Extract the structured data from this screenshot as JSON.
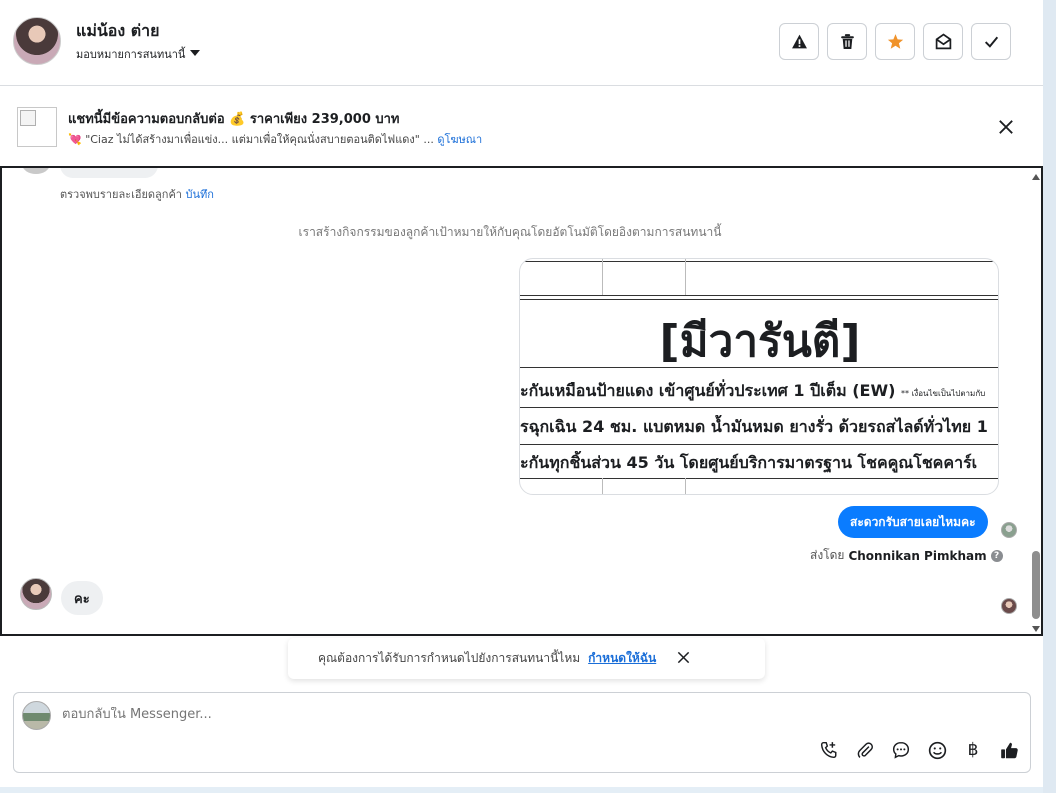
{
  "header": {
    "contact_name": "แม่น้อง ต่าย",
    "assign_label": "มอบหมายการสนทนานี้",
    "buttons": {
      "spam_icon": "warning-icon",
      "delete_icon": "trash-icon",
      "star_icon": "star-icon",
      "unread_icon": "envelope-open-icon",
      "done_icon": "checkmark-icon"
    },
    "star_color": "#f0932b"
  },
  "promo": {
    "title": "แชทนี้มีข้อความตอบกลับต่อ 💰 ราคาเพียง 239,000 บาท",
    "subtitle": "💘 \"Ciaz ไม่ได้สร้างมาเพื่อแข่ง... แต่มาเพื่อให้คุณนั่งสบายตอนติดไฟแดง\" ...",
    "link": "ดูโฆษณา"
  },
  "chat": {
    "note_text": "ตรวจพบรายละเอียดลูกค้า",
    "note_link": "บันทึก",
    "system_text": "เราสร้างกิจกรรมของลูกค้าเป้าหมายให้กับคุณโดยอัตโนมัติโดยอิงตามการสนทนานี้",
    "image": {
      "heading": "[มีวารันตี]",
      "rows": [
        "ะกันเหมือนป้ายแดง เข้าศูนย์ทั่วประเทศ 1 ปีเต็ม (EW)",
        "รฉุกเฉิน 24 ชม. แบตหมด น้ำมันหมด ยางรั่ว ด้วยรถสไลด์ทั่วไทย 1",
        "ะกันทุกชิ้นส่วน 45 วัน โดยศูนย์บริการมาตรฐาน โชคคูณโชคคาร์เ"
      ],
      "row1_small": "** เงื่อนไขเป็นไปตามกับ"
    },
    "outgoing_message": "สะดวกรับสายเลยไหมคะ",
    "sent_by_prefix": "ส่งโดย",
    "sent_by_name": "Chonnikan Pimkham",
    "incoming_message": "คะ"
  },
  "assign_banner": {
    "text": "คุณต้องการได้รับการกำหนดไปยังการสนทนานี้ไหม",
    "link": "กำหนดให้ฉัน"
  },
  "composer": {
    "placeholder": "ตอบกลับใน Messenger...",
    "tools": [
      "add-call-icon",
      "paperclip-icon",
      "chat-bubble-icon",
      "smiley-icon",
      "baht-icon",
      "thumbs-up-icon"
    ],
    "baht_symbol": "฿"
  },
  "accent": "#0a7cff"
}
